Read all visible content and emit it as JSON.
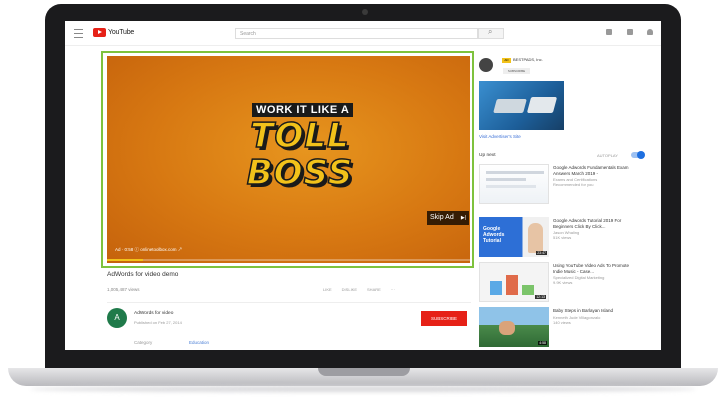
{
  "header": {
    "logo_text": "YouTube",
    "search_placeholder": "Search"
  },
  "video": {
    "headline_small": "WORK IT LIKE A",
    "headline_line1": "TOLL",
    "headline_line2": "BOSS",
    "skip_ad_label": "Skip Ad",
    "ad_info": "Ad · 0:58 ⓘ  onlinetoolbox.com ↗",
    "progress_fraction": 0.1,
    "title": "AdWords for video demo",
    "views": "1,005,487 views",
    "actions": [
      "LIKE",
      "DISLIKE",
      "SHARE",
      "···"
    ]
  },
  "channel": {
    "avatar_letter": "A",
    "name": "AdWords for video",
    "published": "Published on Feb 27, 2014",
    "subscribe_label": "SUBSCRIBE",
    "category_label": "Category",
    "category_value": "Education"
  },
  "sidebar_ad": {
    "badge": "AD",
    "channel_name": "BESTPADS, Inc.",
    "subscribe_label": "SUBSCRIBE",
    "link_text": "Visit Advertiser's Site"
  },
  "up_next": {
    "title": "Up next",
    "autoplay_label": "AUTOPLAY",
    "autoplay_on": true,
    "items": [
      {
        "title": "Google Adwords Fundamentals Exam Answers March 2019 -",
        "line2": "Exams and Certifications",
        "line3": "Recommended for you",
        "duration": ""
      },
      {
        "title": "Google Adwords Tutorial 2019 For Beginners Click By Click...",
        "line2": "Jason Whaling",
        "line3": "51K views",
        "duration": "23:47"
      },
      {
        "title": "Using YouTube Video Ads To Promote Indie Music - Case...",
        "line2": "Specialized Digital Marketing",
        "line3": "9.9K views",
        "duration": "12:13"
      },
      {
        "title": "Baby Steps in Barlayan Island",
        "line2": "Kenneth Jude Villagonzalo",
        "line3": "140 views",
        "duration": "4:58"
      }
    ]
  }
}
